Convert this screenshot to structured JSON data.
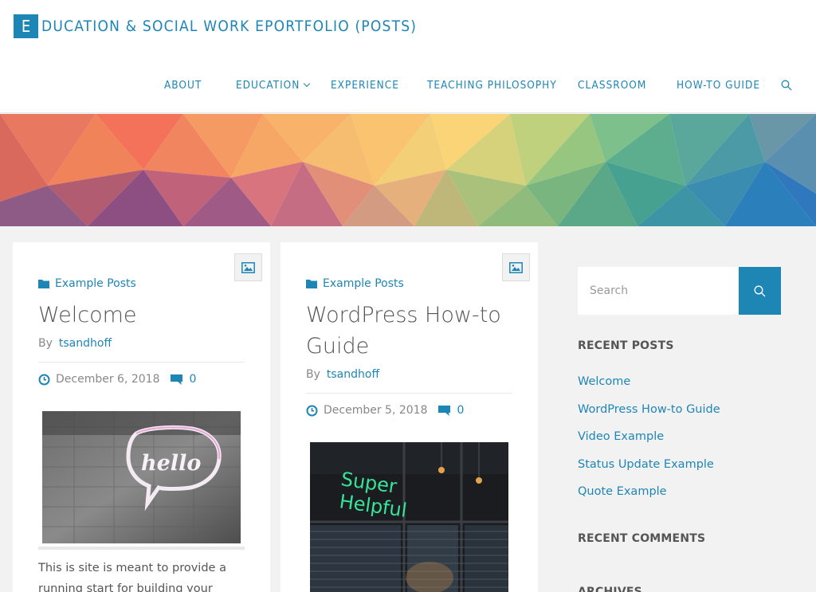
{
  "site": {
    "title_initial": "E",
    "title_rest": "DUCATION & SOCIAL WORK EPORTFOLIO (POSTS)"
  },
  "nav": {
    "items": [
      {
        "label": "ABOUT"
      },
      {
        "label": "EDUCATION"
      },
      {
        "label": "EXPERIENCE"
      },
      {
        "label": "TEACHING PHILOSOPHY"
      },
      {
        "label": "CLASSROOM"
      },
      {
        "label": "HOW-TO GUIDE"
      }
    ],
    "search_icon": "search-icon"
  },
  "posts": [
    {
      "category": "Example Posts",
      "title": "Welcome",
      "by": "By",
      "author": "tsandhoff",
      "date": "December 6, 2018",
      "comments": "0",
      "thumb_text": "hello",
      "excerpt_line1": "This is site is meant to provide a",
      "excerpt_line2": "running start for building your"
    },
    {
      "category": "Example Posts",
      "title_line1": "WordPress How-to",
      "title_line2": "Guide",
      "by": "By",
      "author": "tsandhoff",
      "date": "December 5, 2018",
      "comments": "0",
      "thumb_line1": "Super",
      "thumb_line2": "Helpful"
    }
  ],
  "sidebar": {
    "search_placeholder": "Search",
    "recent_posts_title": "RECENT POSTS",
    "recent_posts": [
      "Welcome",
      "WordPress How-to Guide",
      "Video Example",
      "Status Update Example",
      "Quote Example"
    ],
    "recent_comments_title": "RECENT COMMENTS",
    "archives_title": "ARCHIVES"
  },
  "colors": {
    "accent": "#1e86b5",
    "background": "#f2f2f2",
    "text": "#555555"
  }
}
